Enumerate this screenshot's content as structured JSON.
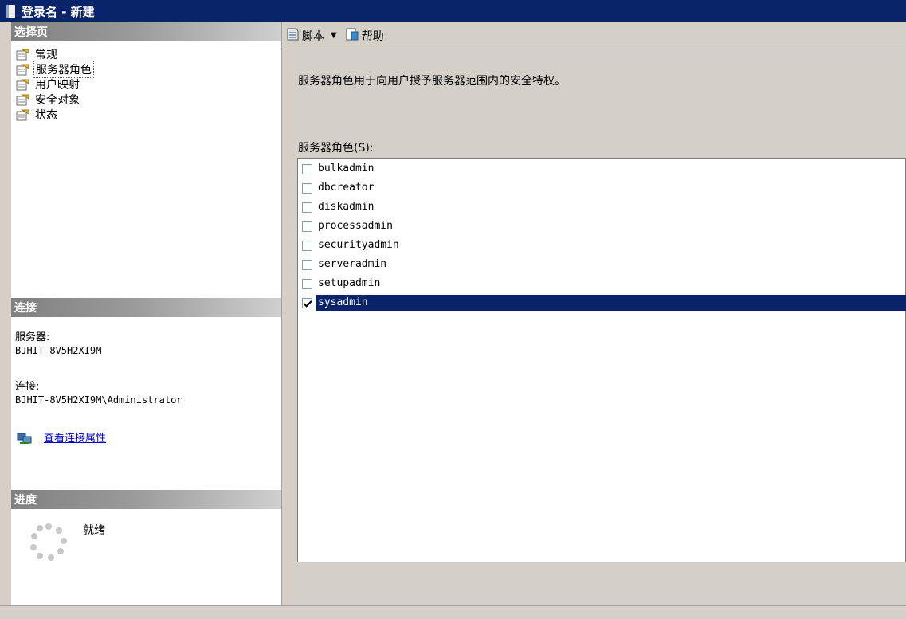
{
  "window": {
    "title": "登录名 - 新建"
  },
  "sidebar": {
    "select_page_header": "选择页",
    "items": [
      {
        "label": "常规",
        "selected": false
      },
      {
        "label": "服务器角色",
        "selected": true
      },
      {
        "label": "用户映射",
        "selected": false
      },
      {
        "label": "安全对象",
        "selected": false
      },
      {
        "label": "状态",
        "selected": false
      }
    ],
    "connection": {
      "header": "连接",
      "server_label": "服务器:",
      "server_value": "BJHIT-8V5H2XI9M",
      "connection_label": "连接:",
      "connection_value": "BJHIT-8V5H2XI9M\\Administrator",
      "view_properties_link": "查看连接属性"
    },
    "progress": {
      "header": "进度",
      "status": "就绪"
    }
  },
  "toolbar": {
    "script_label": "脚本",
    "help_label": "帮助"
  },
  "main": {
    "description": "服务器角色用于向用户授予服务器范围内的安全特权。",
    "roles_label": "服务器角色(S):",
    "roles": [
      {
        "name": "bulkadmin",
        "checked": false
      },
      {
        "name": "dbcreator",
        "checked": false
      },
      {
        "name": "diskadmin",
        "checked": false
      },
      {
        "name": "processadmin",
        "checked": false
      },
      {
        "name": "securityadmin",
        "checked": false
      },
      {
        "name": "serveradmin",
        "checked": false
      },
      {
        "name": "setupadmin",
        "checked": false
      },
      {
        "name": "sysadmin",
        "checked": true,
        "selected": true
      }
    ]
  },
  "colors": {
    "titlebar": "#0a246a",
    "selection": "#0a246a",
    "link": "#0000cc"
  }
}
